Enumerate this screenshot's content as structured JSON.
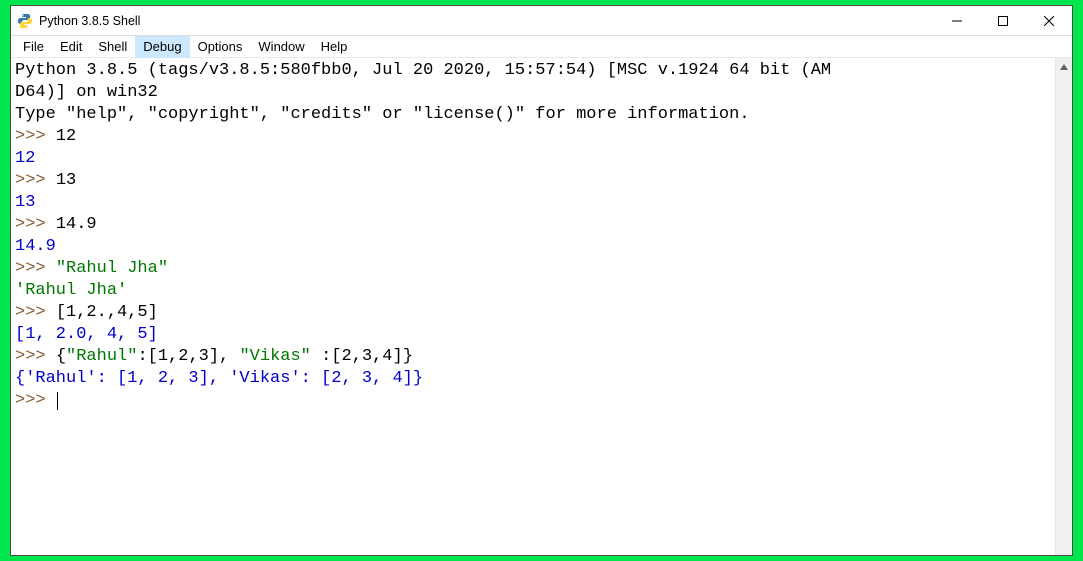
{
  "window": {
    "title": "Python 3.8.5 Shell"
  },
  "menu": {
    "items": [
      "File",
      "Edit",
      "Shell",
      "Debug",
      "Options",
      "Window",
      "Help"
    ],
    "highlighted_index": 3
  },
  "shell": {
    "banner_line1": "Python 3.8.5 (tags/v3.8.5:580fbb0, Jul 20 2020, 15:57:54) [MSC v.1924 64 bit (AM",
    "banner_line2": "D64)] on win32",
    "banner_line3": "Type \"help\", \"copyright\", \"credits\" or \"license()\" for more information.",
    "prompt": ">>> ",
    "entries": [
      {
        "input": "12",
        "input_type": "plain",
        "output": "12",
        "output_type": "num"
      },
      {
        "input": "13",
        "input_type": "plain",
        "output": "13",
        "output_type": "num"
      },
      {
        "input": "14.9",
        "input_type": "plain",
        "output": "14.9",
        "output_type": "num"
      },
      {
        "input": "\"Rahul Jha\"",
        "input_type": "str",
        "output": "'Rahul Jha'",
        "output_type": "str"
      },
      {
        "input": "[1,2.,4,5]",
        "input_type": "plain",
        "output": "[1, 2.0, 4, 5]",
        "output_type": "num"
      },
      {
        "input_parts": [
          {
            "t": "{",
            "c": "plain"
          },
          {
            "t": "\"Rahul\"",
            "c": "str"
          },
          {
            "t": ":[1,2,3], ",
            "c": "plain"
          },
          {
            "t": "\"Vikas\"",
            "c": "str"
          },
          {
            "t": " :[2,3,4]}",
            "c": "plain"
          }
        ],
        "output": "{'Rahul': [1, 2, 3], 'Vikas': [2, 3, 4]}",
        "output_type": "num"
      }
    ]
  }
}
